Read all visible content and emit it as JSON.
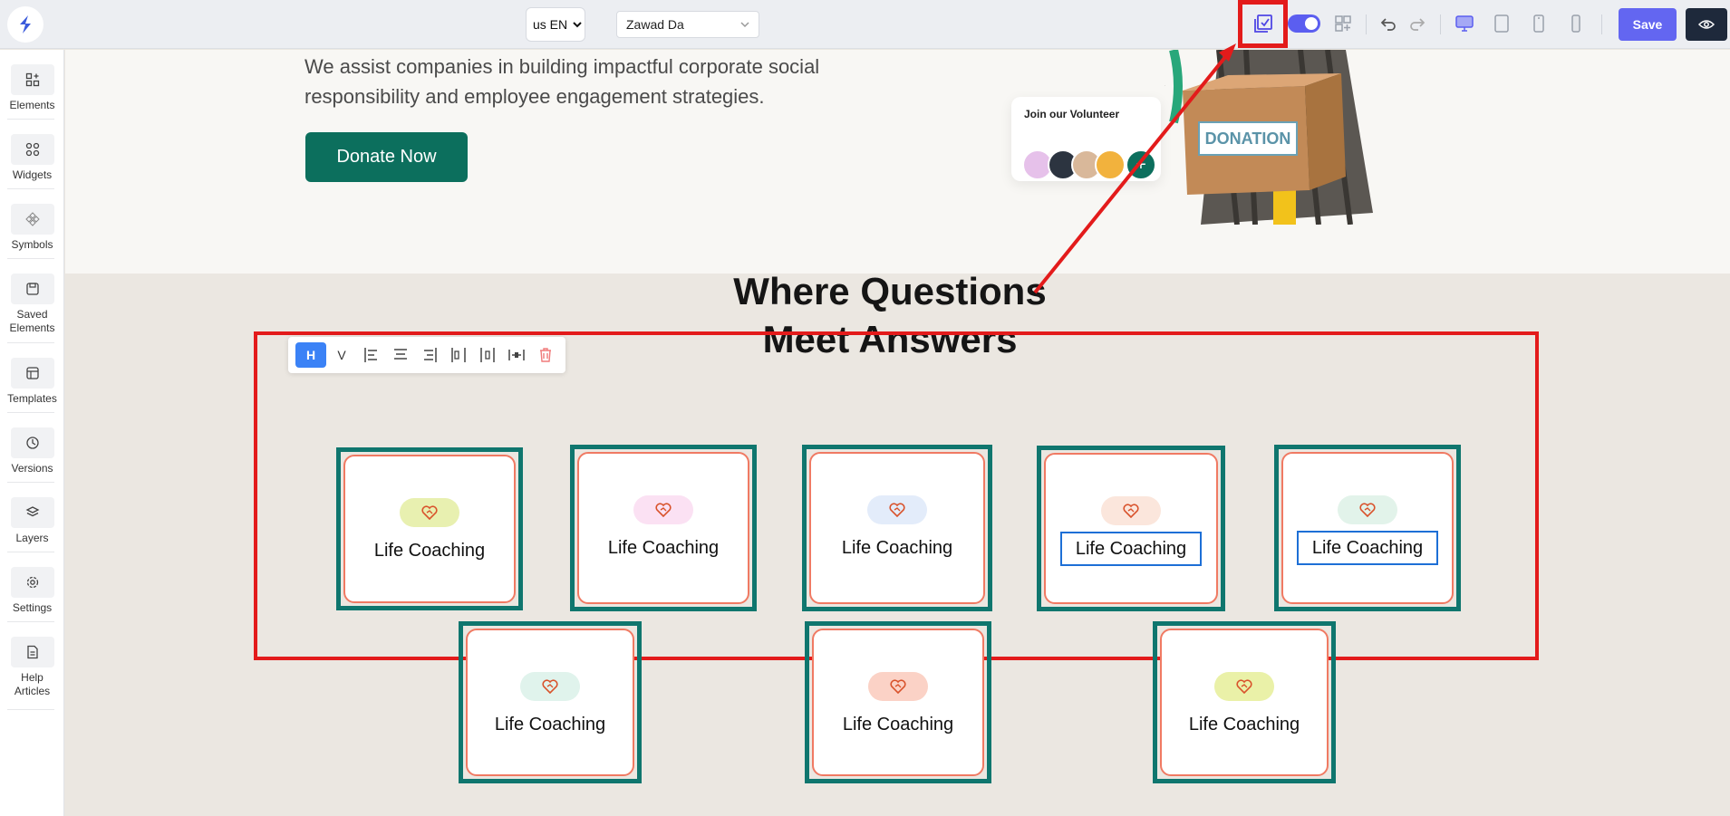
{
  "toolbar": {
    "language": "us EN",
    "user": "Zawad Da",
    "save_label": "Save"
  },
  "sidebar": {
    "items": [
      {
        "label": "Elements"
      },
      {
        "label": "Widgets"
      },
      {
        "label": "Symbols"
      },
      {
        "label": "Saved Elements"
      },
      {
        "label": "Templates"
      },
      {
        "label": "Versions"
      },
      {
        "label": "Layers"
      },
      {
        "label": "Settings"
      },
      {
        "label": "Help Articles"
      }
    ]
  },
  "hero": {
    "description": "We assist companies in building impactful corporate social responsibility and employee engagement strategies.",
    "donate_label": "Donate Now",
    "volunteer_title": "Join our Volunteer",
    "box_label": "DONATION"
  },
  "faq": {
    "title_line1": "Where Questions",
    "title_line2": "Meet Answers",
    "align_toolbar": {
      "h_label": "H",
      "v_label": "V"
    },
    "cards": [
      {
        "label": "Life Coaching",
        "icon_bg": "#e8f0b0"
      },
      {
        "label": "Life Coaching",
        "icon_bg": "#fbe1f3"
      },
      {
        "label": "Life Coaching",
        "icon_bg": "#e3ecfa"
      },
      {
        "label": "Life Coaching",
        "icon_bg": "#fbe6dc"
      },
      {
        "label": "Life Coaching",
        "icon_bg": "#e2f3ea"
      },
      {
        "label": "Life Coaching",
        "icon_bg": "#e0f3ec"
      },
      {
        "label": "Life Coaching",
        "icon_bg": "#fbd2c6"
      },
      {
        "label": "Life Coaching",
        "icon_bg": "#eaf1a8"
      }
    ]
  },
  "colors": {
    "accent": "#6366f1",
    "brand_green": "#0c6f5d",
    "selection_red": "#e31b1b",
    "card_frame": "#0f766e",
    "card_border": "#f07a63"
  }
}
